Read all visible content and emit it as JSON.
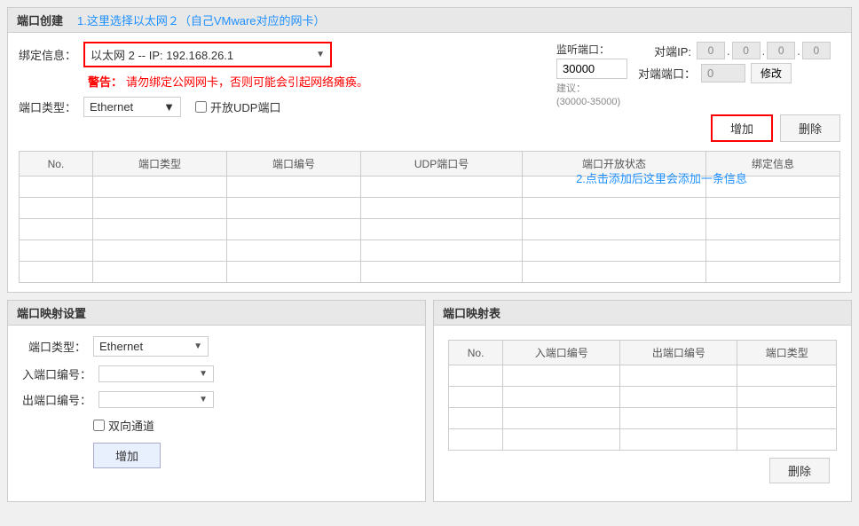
{
  "top_section": {
    "title": "端口创建",
    "annotation1": "1.这里选择以太网２（自己VMware对应的网卡）",
    "bind_label": "绑定信息：",
    "bind_value": "以太网 2 -- IP: 192.168.26.1",
    "warn_label": "警告：",
    "warn_text": "请勿绑定公网网卡，否则可能会引起网络瘫痪。",
    "type_label": "端口类型：",
    "type_value": "Ethernet",
    "udp_label": "开放UDP端口",
    "monitor_label": "监听端口：",
    "monitor_value": "30000",
    "suggest_label": "建议：",
    "suggest_range": "(30000-35000)",
    "peer_ip_label": "对端IP:",
    "peer_ip": [
      "0",
      "0",
      "0",
      "0"
    ],
    "peer_port_label": "对端端口：",
    "peer_port": "0",
    "modify_btn": "修改",
    "add_btn": "增加",
    "delete_btn": "删除",
    "annotation2": "2.点击添加后这里会添加一条信息",
    "table": {
      "headers": [
        "No.",
        "端口类型",
        "端口编号",
        "UDP端口号",
        "端口开放状态",
        "绑定信息"
      ],
      "rows": []
    }
  },
  "bottom_left": {
    "title": "端口映射设置",
    "type_label": "端口类型：",
    "type_value": "Ethernet",
    "in_label": "入端口编号：",
    "out_label": "出端口编号：",
    "bidirectional_label": "双向通道",
    "add_btn": "增加"
  },
  "bottom_right": {
    "title": "端口映射表",
    "table": {
      "headers": [
        "No.",
        "入端口编号",
        "出端口编号",
        "端口类型"
      ],
      "rows": []
    },
    "delete_btn": "删除"
  }
}
